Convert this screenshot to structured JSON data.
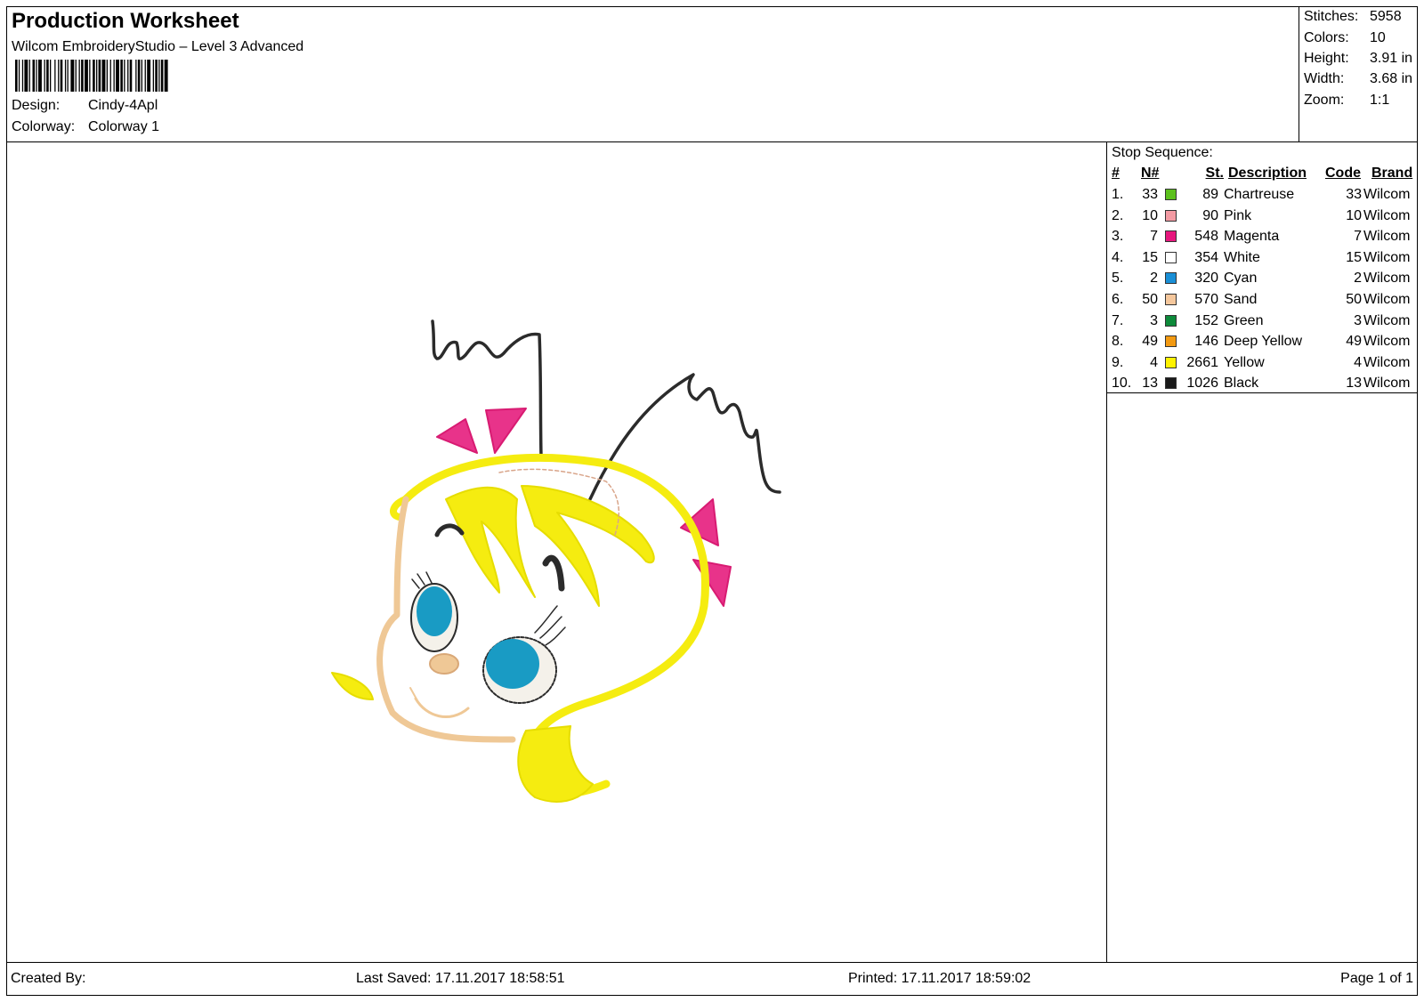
{
  "header": {
    "title": "Production Worksheet",
    "subtitle": "Wilcom EmbroideryStudio – Level 3 Advanced",
    "design_label": "Design:",
    "design_value": "Cindy-4Apl",
    "colorway_label": "Colorway:",
    "colorway_value": "Colorway 1"
  },
  "stats": {
    "stitches_label": "Stitches:",
    "stitches_value": "5958",
    "colors_label": "Colors:",
    "colors_value": "10",
    "height_label": "Height:",
    "height_value": "3.91 in",
    "width_label": "Width:",
    "width_value": "3.68 in",
    "zoom_label": "Zoom:",
    "zoom_value": "1:1"
  },
  "sequence": {
    "title": "Stop Sequence:",
    "columns": [
      "#",
      "N#",
      "St.",
      "Description",
      "Code",
      "Brand"
    ],
    "rows": [
      {
        "num": "1.",
        "n": "33",
        "color": "#5cc11d",
        "st": "89",
        "desc": "Chartreuse",
        "code": "33",
        "brand": "Wilcom"
      },
      {
        "num": "2.",
        "n": "10",
        "color": "#f39aa3",
        "st": "90",
        "desc": "Pink",
        "code": "10",
        "brand": "Wilcom"
      },
      {
        "num": "3.",
        "n": "7",
        "color": "#e6177d",
        "st": "548",
        "desc": "Magenta",
        "code": "7",
        "brand": "Wilcom"
      },
      {
        "num": "4.",
        "n": "15",
        "color": "#ffffff",
        "st": "354",
        "desc": "White",
        "code": "15",
        "brand": "Wilcom"
      },
      {
        "num": "5.",
        "n": "2",
        "color": "#1a8fd6",
        "st": "320",
        "desc": "Cyan",
        "code": "2",
        "brand": "Wilcom"
      },
      {
        "num": "6.",
        "n": "50",
        "color": "#f5c79c",
        "st": "570",
        "desc": "Sand",
        "code": "50",
        "brand": "Wilcom"
      },
      {
        "num": "7.",
        "n": "3",
        "color": "#0d8a3a",
        "st": "152",
        "desc": "Green",
        "code": "3",
        "brand": "Wilcom"
      },
      {
        "num": "8.",
        "n": "49",
        "color": "#f39a12",
        "st": "146",
        "desc": "Deep Yellow",
        "code": "49",
        "brand": "Wilcom"
      },
      {
        "num": "9.",
        "n": "4",
        "color": "#fff200",
        "st": "2661",
        "desc": "Yellow",
        "code": "4",
        "brand": "Wilcom"
      },
      {
        "num": "10.",
        "n": "13",
        "color": "#1a1a1a",
        "st": "1026",
        "desc": "Black",
        "code": "13",
        "brand": "Wilcom"
      }
    ]
  },
  "footer": {
    "created_by": "Created By:",
    "last_saved": "Last Saved: 17.11.2017 18:58:51",
    "printed": "Printed: 17.11.2017 18:59:02",
    "page": "Page 1 of 1"
  }
}
